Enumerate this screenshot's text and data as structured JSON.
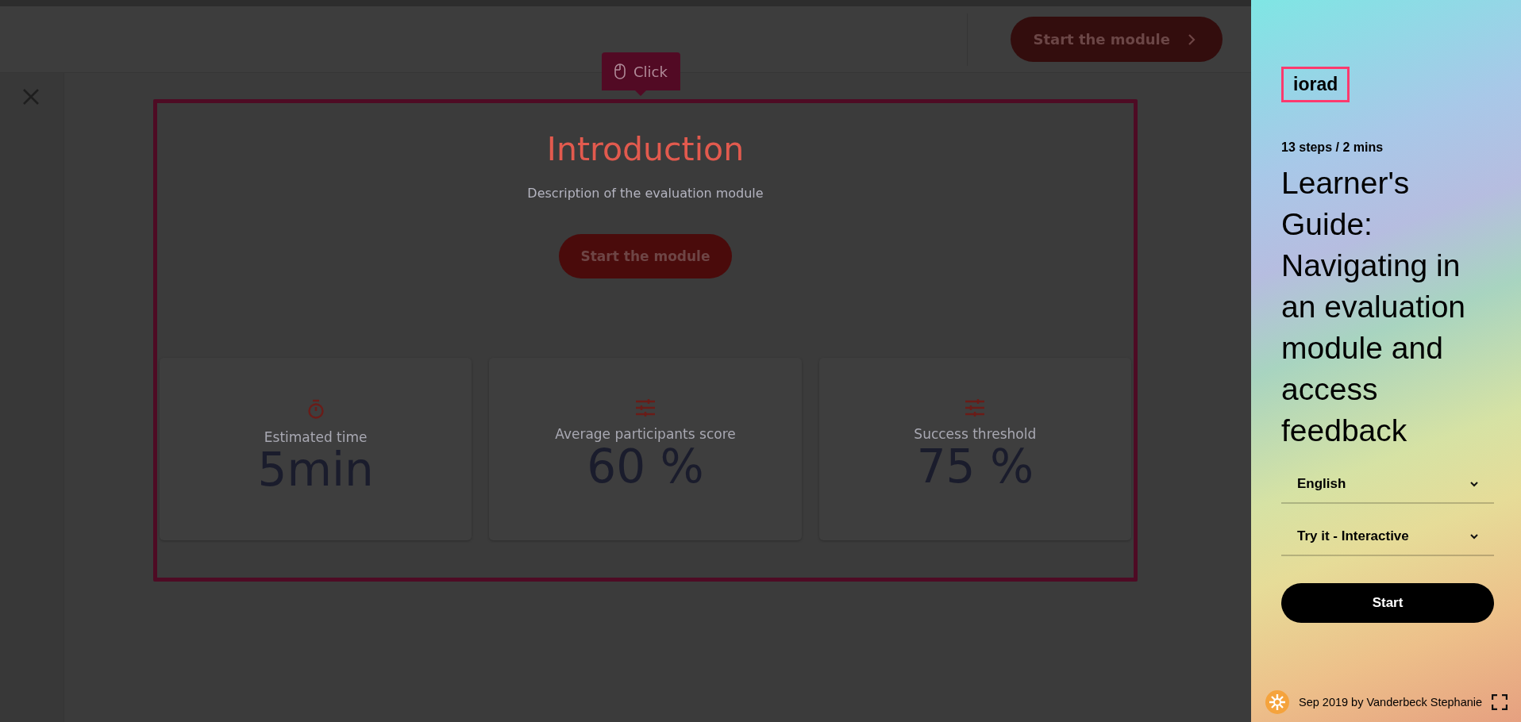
{
  "header": {
    "start_button": "Start the module"
  },
  "tooltip": {
    "label": "Click"
  },
  "module": {
    "title": "Introduction",
    "description": "Description of the evaluation module",
    "start_button": "Start the module",
    "stats": [
      {
        "kind": "timer",
        "label": "Estimated time",
        "value": "5min"
      },
      {
        "kind": "sliders",
        "label": "Average participants score",
        "value": "60 %"
      },
      {
        "kind": "sliders",
        "label": "Success threshold",
        "value": "75 %"
      }
    ]
  },
  "guide": {
    "logo": "iorad",
    "meta": "13 steps / 2 mins",
    "title": "Learner's Guide: Navigating in an evaluation module and access feedback",
    "selects": [
      {
        "value": "English"
      },
      {
        "value": "Try it - Interactive"
      }
    ],
    "start_button": "Start",
    "footer": "Sep 2019 by Vanderbeck Stephanie"
  }
}
